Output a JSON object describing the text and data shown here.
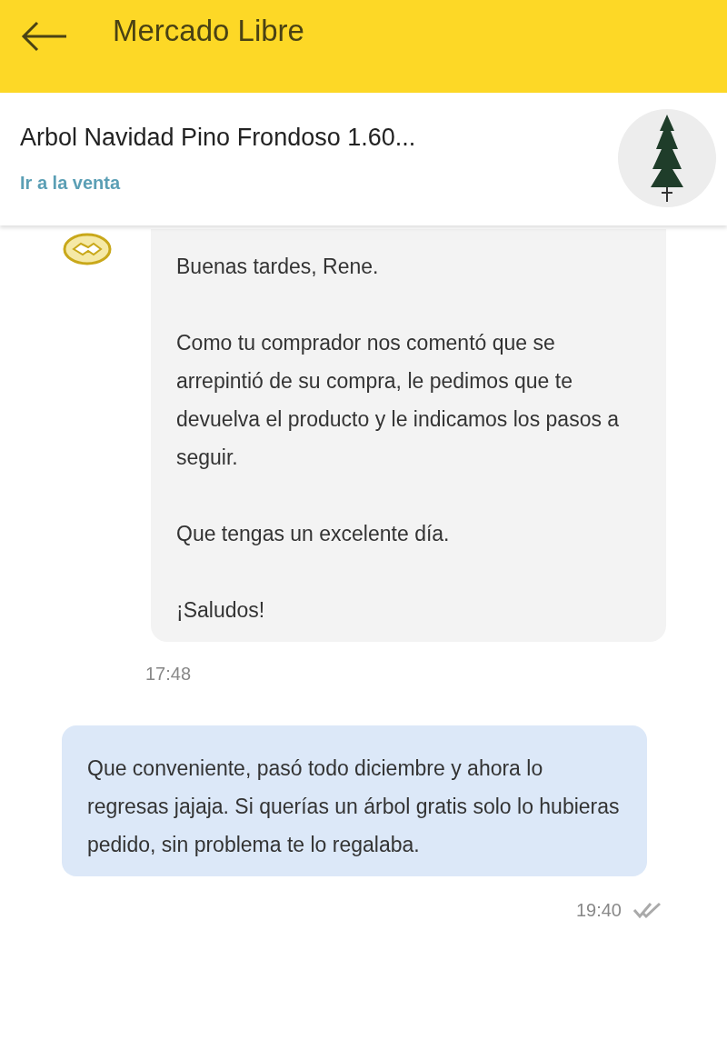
{
  "header": {
    "title": "Mercado Libre"
  },
  "product": {
    "title": "Arbol Navidad Pino Frondoso 1.60...",
    "link": "Ir a la venta"
  },
  "messages": [
    {
      "kind": "received",
      "paragraphs": [
        "Buenas tardes, Rene.",
        "Como tu comprador nos comentó que se arrepintió de su compra, le pedimos que te devuelva el producto y le indicamos los pasos a seguir.",
        "Que tengas un excelente día.",
        "¡Saludos!"
      ],
      "time": "17:48"
    },
    {
      "kind": "sent",
      "paragraphs": [
        "Que conveniente, pasó todo diciembre y ahora lo regresas jajaja. Si querías un árbol gratis solo lo hubieras pedido, sin problema te lo regalaba."
      ],
      "time": "19:40"
    }
  ]
}
